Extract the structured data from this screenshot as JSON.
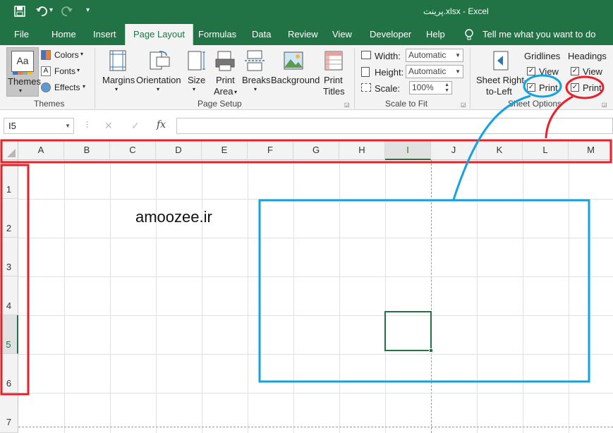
{
  "window": {
    "title": "پرینت.xlsx  -  Excel"
  },
  "qat": {
    "undo_arrow": "▾",
    "more": "▾"
  },
  "tabs": [
    "File",
    "Home",
    "Insert",
    "Page Layout",
    "Formulas",
    "Data",
    "Review",
    "View",
    "Developer",
    "Help"
  ],
  "tell_me": "Tell me what you want to do",
  "ribbon": {
    "themes": {
      "themes_label": "Themes",
      "aa": "Aa",
      "colors": "Colors",
      "fonts": "Fonts",
      "effects": "Effects",
      "group": "Themes"
    },
    "page_setup": {
      "margins": "Margins",
      "orientation": "Orientation",
      "size": "Size",
      "print_area_1": "Print",
      "print_area_2": "Area",
      "breaks": "Breaks",
      "background": "Background",
      "print_titles_1": "Print",
      "print_titles_2": "Titles",
      "group": "Page Setup"
    },
    "scale": {
      "width_label": "Width:",
      "width_value": "Automatic",
      "height_label": "Height:",
      "height_value": "Automatic",
      "scale_label": "Scale:",
      "scale_value": "100%",
      "group": "Scale to Fit"
    },
    "sheet_options": {
      "rtl_1": "Sheet Right-",
      "rtl_2": "to-Left",
      "gridlines": "Gridlines",
      "headings": "Headings",
      "view": "View",
      "print": "Print",
      "group": "Sheet Options",
      "check": "✓",
      "gridlines_view": true,
      "gridlines_print": true,
      "headings_view": true,
      "headings_print": true
    }
  },
  "formula_bar": {
    "name_box": "I5",
    "cancel": "✕",
    "enter": "✓",
    "fx": "fx",
    "formula": ""
  },
  "sheet": {
    "columns": [
      "A",
      "B",
      "C",
      "D",
      "E",
      "F",
      "G",
      "H",
      "I",
      "J",
      "K",
      "L",
      "M"
    ],
    "rows": [
      "1",
      "2",
      "3",
      "4",
      "5",
      "6",
      "7"
    ],
    "selected_cell": "I5",
    "watermark": "amoozee.ir"
  },
  "colors": {
    "excel_green": "#217346",
    "annotation_red": "#e8202a",
    "annotation_blue": "#12a3e0"
  }
}
